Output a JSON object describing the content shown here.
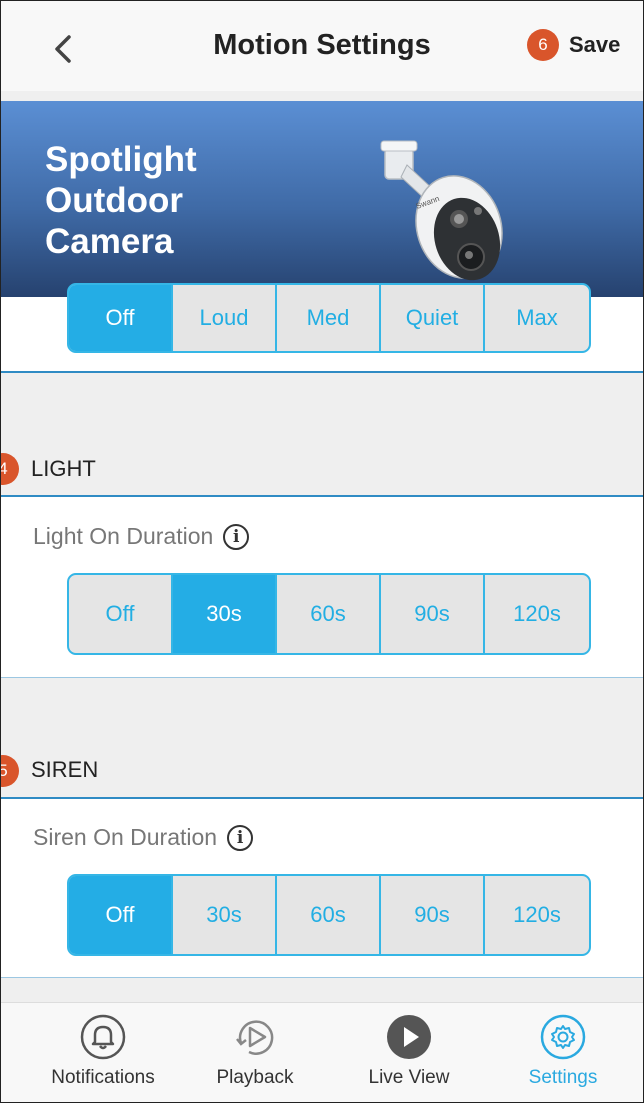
{
  "header": {
    "title": "Motion Settings",
    "save_label": "Save",
    "save_badge": "6"
  },
  "banner": {
    "title": "Spotlight Outdoor Camera"
  },
  "volume": {
    "options": [
      "Off",
      "Loud",
      "Med",
      "Quiet",
      "Max"
    ],
    "selected": "Off"
  },
  "light": {
    "badge": "4",
    "heading": "LIGHT",
    "label": "Light On Duration",
    "options": [
      "Off",
      "30s",
      "60s",
      "90s",
      "120s"
    ],
    "selected": "30s"
  },
  "siren": {
    "badge": "5",
    "heading": "SIREN",
    "label": "Siren On Duration",
    "options": [
      "Off",
      "30s",
      "60s",
      "90s",
      "120s"
    ],
    "selected": "Off"
  },
  "nav": {
    "items": [
      {
        "label": "Notifications",
        "icon": "bell-icon"
      },
      {
        "label": "Playback",
        "icon": "playback-icon"
      },
      {
        "label": "Live View",
        "icon": "play-icon"
      },
      {
        "label": "Settings",
        "icon": "gear-icon"
      }
    ],
    "active": "Settings",
    "active_color": "#2aa9e0"
  },
  "colors": {
    "accent": "#24ade5",
    "badge": "#d9552b",
    "rule": "#2f8bc4"
  }
}
